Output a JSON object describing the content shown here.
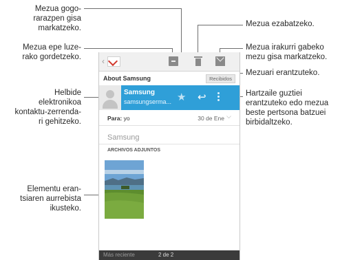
{
  "callouts": {
    "favorite": "Mezua gogo-\nrarazpen gisa\nmarkatzeko.",
    "delete": "Mezua ezabatzeko.",
    "save_later": "Mezua epe luze-\nrako gordetzeko.",
    "mark_unread": "Mezua irakurri gabeko\nmezu gisa markatzeko.",
    "reply": "Mezuari erantzuteko.",
    "add_contact": "Helbide\nelektronikoa\nkontaktu-zerrenda-\nri gehitzeko.",
    "reply_all": "Hartzaile guztiei\nerantzuteko edo mezua\nbeste pertsona batzuei\nbirbidaltzeko.",
    "preview": "Elementu eran-\ntsiaren aurrebista\nikusteko."
  },
  "phone": {
    "back_glyph": "‹",
    "toolbar_icons": [
      "archive-icon",
      "trash-icon",
      "mail-unread-icon"
    ],
    "subject": "About Samsung",
    "folder_badge": "Recibidos",
    "sender_name": "Samsung",
    "sender_email": "samsungserma...",
    "to_label": "Para:",
    "to_value": "yo",
    "date": "30 de Ene",
    "body_text": "Samsung",
    "attachments_label": "ARCHIVOS ADJUNTOS",
    "footer_prev": "Más reciente",
    "footer_position": "2 de 2"
  },
  "colors": {
    "accent": "#2f9fd8",
    "toolbar_bg": "#f0f0f0",
    "footer_bg": "#3b3b3b"
  }
}
